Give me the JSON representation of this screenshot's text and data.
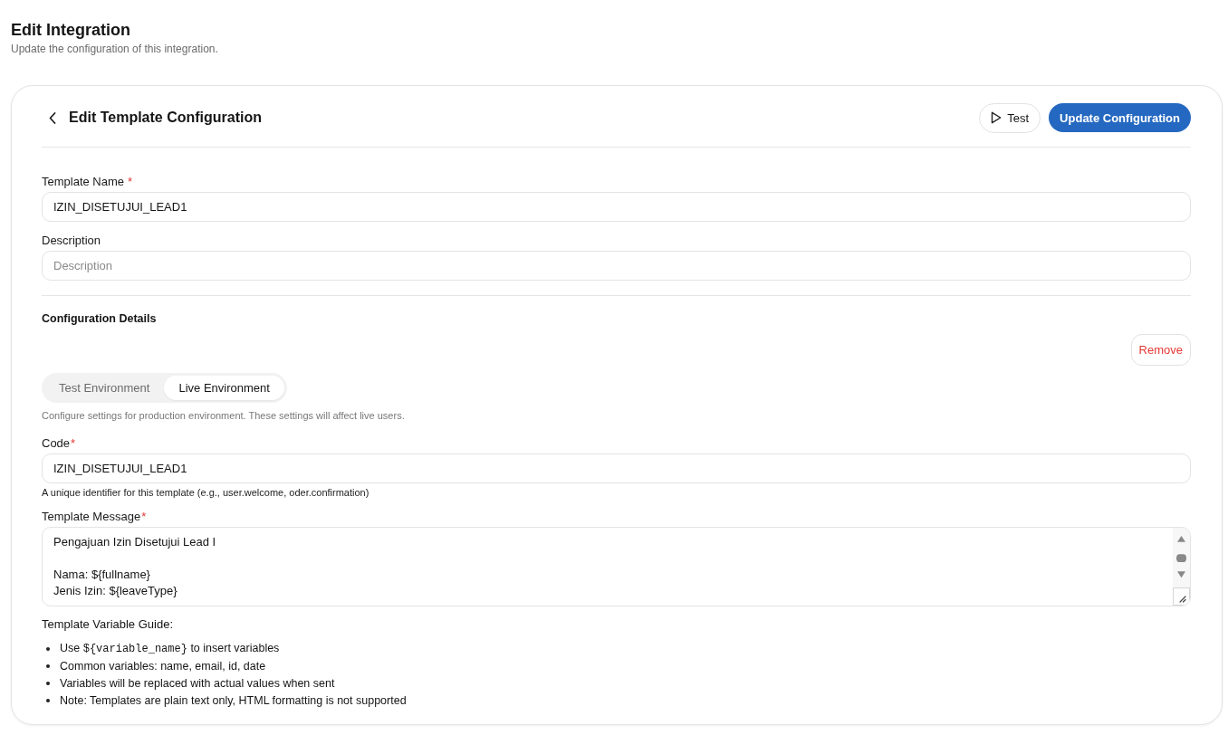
{
  "page": {
    "title": "Edit Integration",
    "subtitle": "Update the configuration of this integration."
  },
  "card": {
    "title": "Edit Template Configuration",
    "buttons": [
      {
        "kind": "run",
        "label": "Test"
      },
      {
        "kind": "primary",
        "label": "Update Configuration"
      }
    ],
    "fields": [
      {
        "label": "Template Name",
        "required_mark": "*",
        "value": "IZIN_DISETUJUI_LEAD1"
      },
      {
        "label": "Description",
        "placeholder": "Description"
      }
    ],
    "configuration": {
      "title": "Configuration Details",
      "remove_button": "Remove",
      "environments": [
        {
          "label": "Test Environment",
          "selected": false
        },
        {
          "label": "Live Environment",
          "selected": true
        }
      ],
      "environment_note": "Configure settings for production environment. These settings will affect live users.",
      "code_field": {
        "label": "Code",
        "required_mark": "*",
        "value": "IZIN_DISETUJUI_LEAD1",
        "hint": "A unique identifier for this template (e.g., user.welcome, oder.confirmation)"
      },
      "message_field": {
        "label": "Template Message",
        "required_mark": "*",
        "value": "Pengajuan Izin Disetujui Lead I\n\nNama: ${fullname}\nJenis Izin: ${leaveType}"
      },
      "guide": {
        "title": "Template Variable Guide:",
        "items": [
          {
            "kind": "code",
            "prefix": "Use",
            "code": "${variable_name}",
            "suffix": "to insert variables"
          },
          {
            "kind": "text",
            "text": "Common variables: name, email, id, date"
          },
          {
            "kind": "text",
            "text": "Variables will be replaced with actual values when sent"
          },
          {
            "kind": "text",
            "text": "Note: Templates are plain text only, HTML formatting is not supported"
          }
        ]
      }
    }
  }
}
